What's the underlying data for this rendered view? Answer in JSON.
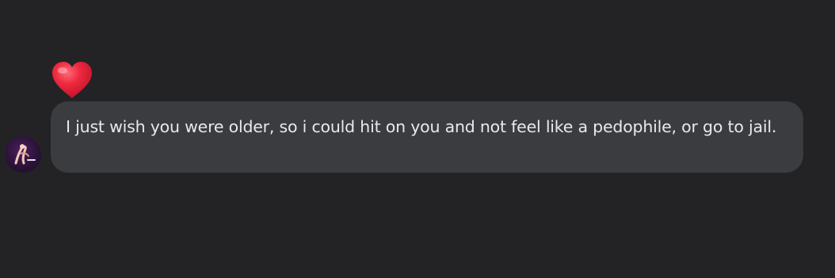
{
  "message": {
    "text": "I just wish you were older, so i could hit on you and not feel like a pedophile, or go to jail.",
    "reaction_icon": "heart-icon",
    "reaction_color": "#e0243a"
  },
  "sender": {
    "avatar_icon": "avatar"
  },
  "colors": {
    "background": "#232326",
    "bubble": "#3b3c40",
    "text": "#e9e9eb"
  }
}
